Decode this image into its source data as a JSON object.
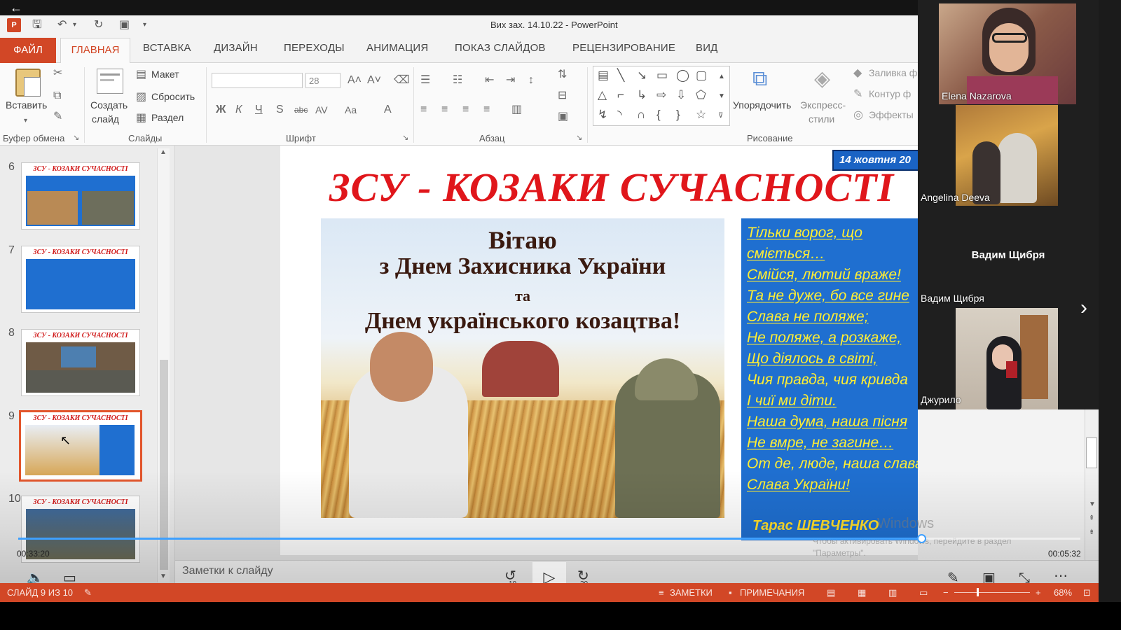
{
  "window": {
    "title": "Вих зах. 14.10.22 - PowerPoint"
  },
  "tabs": {
    "file": "ФАЙЛ",
    "home": "ГЛАВНАЯ",
    "insert": "ВСТАВКА",
    "design": "ДИЗАЙН",
    "transitions": "ПЕРЕХОДЫ",
    "animation": "АНИМАЦИЯ",
    "slideshow": "ПОКАЗ СЛАЙДОВ",
    "review": "РЕЦЕНЗИРОВАНИЕ",
    "view": "ВИД"
  },
  "ribbon": {
    "paste": "Вставить",
    "new_slide_1": "Создать",
    "new_slide_2": "слайд",
    "layout": "Макет",
    "reset": "Сбросить",
    "section": "Раздел",
    "font_size": "28",
    "arrange": "Упорядочить",
    "quick_styles_1": "Экспресс-",
    "quick_styles_2": "стили",
    "fill": "Заливка ф",
    "outline": "Контур ф",
    "effects": "Эффекты",
    "groups": {
      "clipboard": "Буфер обмена",
      "slides": "Слайды",
      "font": "Шрифт",
      "paragraph": "Абзац",
      "drawing": "Рисование"
    },
    "font_buttons": [
      "Ж",
      "К",
      "Ч",
      "S",
      "abc",
      "AV",
      "Aa",
      "A"
    ]
  },
  "thumbnails": [
    {
      "num": "6",
      "title": "ЗСУ - КОЗАКИ СУЧАСНОСТІ"
    },
    {
      "num": "7",
      "title": "ЗСУ - КОЗАКИ СУЧАСНОСТІ"
    },
    {
      "num": "8",
      "title": "ЗСУ - КОЗАКИ СУЧАСНОСТІ"
    },
    {
      "num": "9",
      "title": "ЗСУ - КОЗАКИ СУЧАСНОСТІ"
    },
    {
      "num": "10",
      "title": "ЗСУ - КОЗАКИ СУЧАСНОСТІ"
    }
  ],
  "slide": {
    "title": "ЗСУ - КОЗАКИ СУЧАСНОСТІ",
    "date": "14 жовтня 20",
    "greeting": {
      "line1": "Вітаю",
      "line2": "з Днем Захисника України",
      "line3": "та",
      "line4": "Днем українського козацтва!"
    },
    "poem": [
      "Тільки ворог, що",
      "сміється…",
      "Смійся, лютий враже!",
      "Та не дуже, бо все гине",
      "Слава не поляже;",
      "Не поляже, а розкаже,",
      "Що діялось в світі,",
      "Чия правда, чия кривда",
      "І чиї ми діти.",
      "Наша дума, наша пісня",
      "Не вмре, не загине…",
      "От де, люде, наша слава,",
      "Слава України!"
    ],
    "author": "Тарас ШЕВЧЕНКО"
  },
  "notes": {
    "placeholder": "Заметки к слайду"
  },
  "watermark": {
    "line1": "Windows",
    "line2": "Чтобы активировать Windows, перейдите в раздел \"Параметры\"."
  },
  "player": {
    "elapsed": "00:33:20",
    "remaining": "00:05:32",
    "progress": 0.85,
    "rewind": "10",
    "forward": "30"
  },
  "participants": [
    {
      "name": "Elena Nazarova"
    },
    {
      "name": "Angelina Deeva"
    },
    {
      "name": "Вадим Щибря",
      "center_label": "Вадим Щибря"
    },
    {
      "name": "Джурило"
    }
  ],
  "status": {
    "slide_counter": "СЛАЙД 9 ИЗ 10",
    "notes": "ЗАМЕТКИ",
    "comments": "ПРИМЕЧАНИЯ",
    "zoom": "68%"
  }
}
